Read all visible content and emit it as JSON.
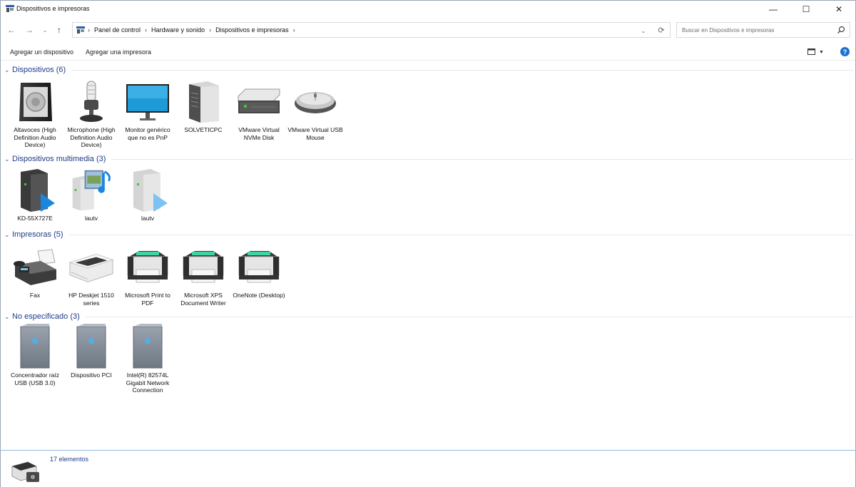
{
  "window": {
    "title": "Dispositivos e impresoras",
    "minimize_label": "—",
    "maximize_label": "☐",
    "close_label": "✕"
  },
  "nav": {
    "back_label": "←",
    "forward_label": "→",
    "recent_label": "⌄",
    "up_label": "↑"
  },
  "address": {
    "crumbs": [
      "Panel de control",
      "Hardware y sonido",
      "Dispositivos e impresoras"
    ],
    "separator": "›"
  },
  "search": {
    "placeholder": "Buscar en Dispositivos e impresoras"
  },
  "commands": {
    "add_device": "Agregar un dispositivo",
    "add_printer": "Agregar una impresora",
    "help": "?"
  },
  "groups": [
    {
      "title": "Dispositivos (6)",
      "items": [
        {
          "label": "Altavoces (High Definition Audio Device)",
          "icon": "speaker-icon"
        },
        {
          "label": "Microphone (High Definition Audio Device)",
          "icon": "microphone-icon"
        },
        {
          "label": "Monitor genérico que no es PnP",
          "icon": "monitor-icon"
        },
        {
          "label": "SOLVETICPC",
          "icon": "pc-tower-icon"
        },
        {
          "label": "VMware Virtual NVMe Disk",
          "icon": "disk-drive-icon"
        },
        {
          "label": "VMware Virtual USB Mouse",
          "icon": "mouse-icon"
        }
      ]
    },
    {
      "title": "Dispositivos multimedia (3)",
      "items": [
        {
          "label": "KD-55X727E",
          "icon": "media-device-icon"
        },
        {
          "label": "lautv",
          "icon": "media-library-icon"
        },
        {
          "label": "lautv",
          "icon": "media-server-icon"
        }
      ]
    },
    {
      "title": "Impresoras (5)",
      "items": [
        {
          "label": "Fax",
          "icon": "fax-icon"
        },
        {
          "label": "HP Deskjet 1510 series",
          "icon": "inkjet-printer-icon"
        },
        {
          "label": "Microsoft Print to PDF",
          "icon": "printer-icon"
        },
        {
          "label": "Microsoft XPS Document Writer",
          "icon": "printer-icon"
        },
        {
          "label": "OneNote (Desktop)",
          "icon": "printer-icon"
        }
      ]
    },
    {
      "title": "No especificado (3)",
      "items": [
        {
          "label": "Concentrador raíz USB (USB 3.0)",
          "icon": "generic-device-icon"
        },
        {
          "label": "Dispositivo PCI",
          "icon": "generic-device-icon"
        },
        {
          "label": "Intel(R) 82574L Gigabit Network Connection",
          "icon": "generic-device-icon"
        }
      ]
    }
  ],
  "status": {
    "count": "17 elementos",
    "icon": "devices-printers-icon"
  },
  "colors": {
    "group_title": "#1e3c8a",
    "accent": "#1a73d1",
    "media_play": "#1a86e0"
  }
}
